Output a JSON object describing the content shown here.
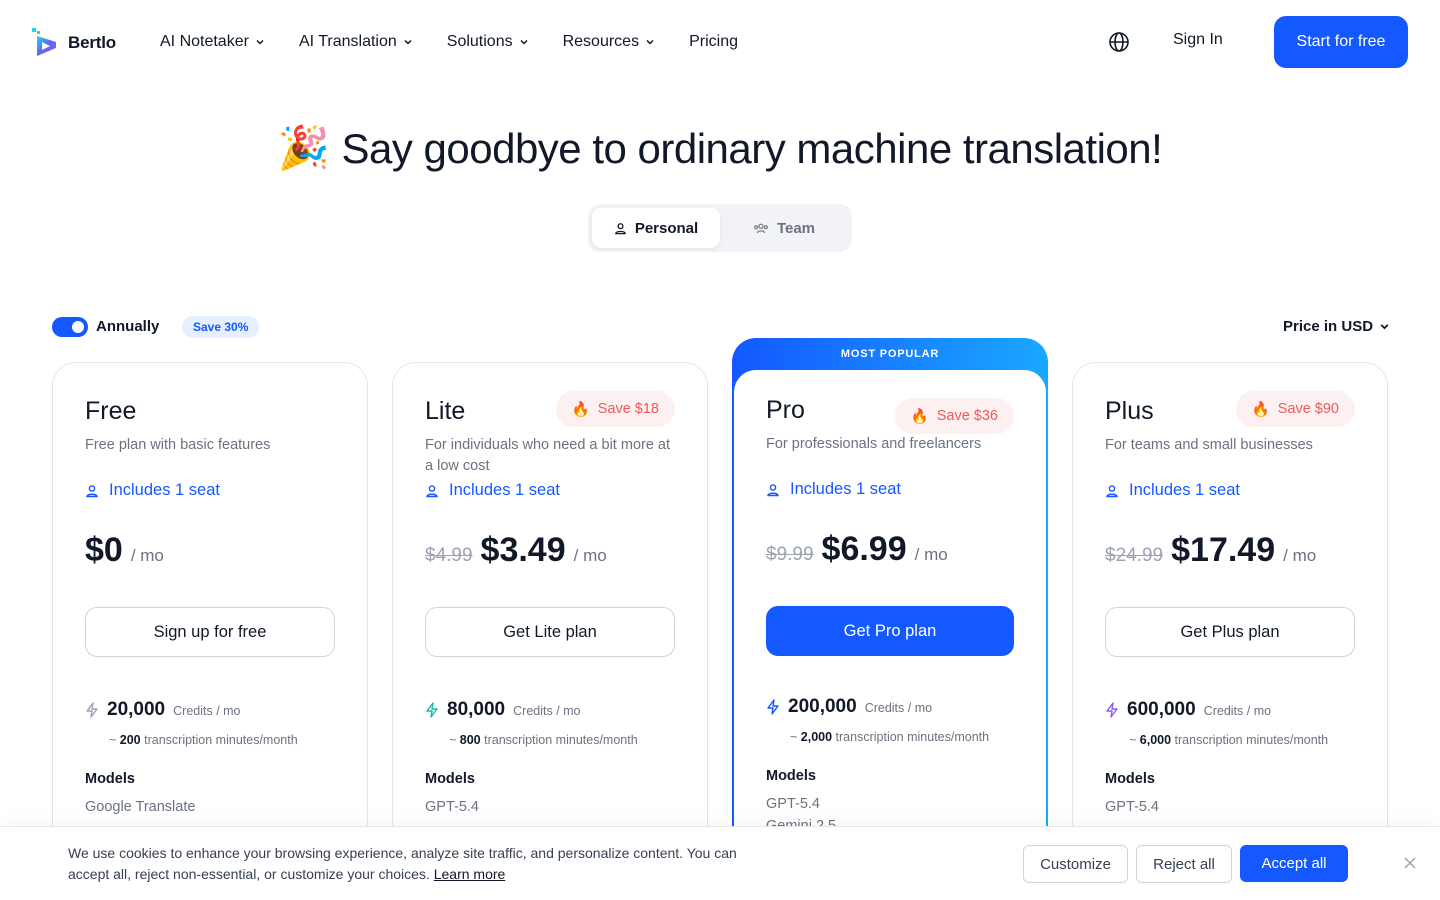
{
  "header": {
    "brand": "Bertlo",
    "nav": [
      {
        "label": "AI Notetaker",
        "dropdown": true
      },
      {
        "label": "AI Translation",
        "dropdown": true
      },
      {
        "label": "Solutions",
        "dropdown": true
      },
      {
        "label": "Resources",
        "dropdown": true
      },
      {
        "label": "Pricing",
        "dropdown": false
      }
    ],
    "globe_icon": "globe-icon",
    "sign_in": "Sign In",
    "cta": "Start for free"
  },
  "hero": {
    "emoji": "🎉",
    "title": "Say goodbye to ordinary machine translation!",
    "tabs": [
      {
        "label": "Personal",
        "icon": "user-icon",
        "active": true
      },
      {
        "label": "Team",
        "icon": "users-icon",
        "active": false
      }
    ]
  },
  "billing": {
    "toggle_on": true,
    "period_label": "Annually",
    "save_badge": "Save 30%",
    "currency_label": "Price in USD"
  },
  "plans": [
    {
      "name": "Free",
      "description": "Free plan with basic features",
      "seat": "Includes 1 seat",
      "save": "",
      "old_price": "",
      "price": "$0",
      "per": "/ mo",
      "button": "Sign up for free",
      "credits": "20,000",
      "credits_unit": "Credits / mo",
      "minutes": "200",
      "minutes_suffix": "transcription minutes/month",
      "models_label": "Models",
      "models": [
        "Google Translate"
      ],
      "bolt_color": "#9ca3af"
    },
    {
      "name": "Lite",
      "description": "For individuals who need a bit more at a low cost",
      "seat": "Includes 1 seat",
      "save": "Save $18",
      "old_price": "$4.99",
      "price": "$3.49",
      "per": "/ mo",
      "button": "Get Lite plan",
      "credits": "80,000",
      "credits_unit": "Credits / mo",
      "minutes": "800",
      "minutes_suffix": "transcription minutes/month",
      "models_label": "Models",
      "models": [
        "GPT-5.4"
      ],
      "bolt_color": "#14b8a6"
    },
    {
      "name": "Pro",
      "banner": "MOST POPULAR",
      "description": "For professionals and freelancers",
      "seat": "Includes 1 seat",
      "save": "Save $36",
      "old_price": "$9.99",
      "price": "$6.99",
      "per": "/ mo",
      "button": "Get Pro plan",
      "credits": "200,000",
      "credits_unit": "Credits / mo",
      "minutes": "2,000",
      "minutes_suffix": "transcription minutes/month",
      "models_label": "Models",
      "models": [
        "GPT-5.4",
        "Gemini 2.5"
      ],
      "bolt_color": "#1458ff"
    },
    {
      "name": "Plus",
      "description": "For teams and small businesses",
      "seat": "Includes 1 seat",
      "save": "Save $90",
      "old_price": "$24.99",
      "price": "$17.49",
      "per": "/ mo",
      "button": "Get Plus plan",
      "credits": "600,000",
      "credits_unit": "Credits / mo",
      "minutes": "6,000",
      "minutes_suffix": "transcription minutes/month",
      "models_label": "Models",
      "models": [
        "GPT-5.4"
      ],
      "bolt_color": "#8b5cf6"
    }
  ],
  "cookie": {
    "text": "We use cookies to enhance your browsing experience, analyze site traffic, and personalize content. You can accept all, reject non-essential, or customize your choices.",
    "learn_more": "Learn more",
    "customize": "Customize",
    "reject": "Reject all",
    "accept": "Accept all"
  },
  "colors": {
    "accent": "#1458ff",
    "save_text": "#ef5a5a"
  }
}
